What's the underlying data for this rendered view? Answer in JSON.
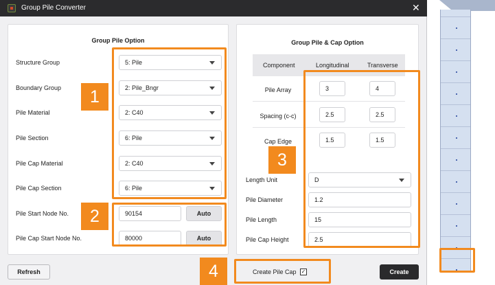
{
  "dialog": {
    "title": "Group Pile Converter",
    "close_glyph": "✕"
  },
  "left_panel": {
    "title": "Group Pile Option",
    "rows": [
      {
        "label": "Structure Group",
        "value": "5: Pile"
      },
      {
        "label": "Boundary Group",
        "value": "2: Pile_Bngr"
      },
      {
        "label": "Pile Material",
        "value": "2: C40"
      },
      {
        "label": "Pile Section",
        "value": "6: Pile"
      },
      {
        "label": "Pile Cap Material",
        "value": "2: C40"
      },
      {
        "label": "Pile Cap Section",
        "value": "6: Pile"
      }
    ],
    "node_rows": [
      {
        "label": "Pile Start Node No.",
        "value": "90154",
        "button": "Auto"
      },
      {
        "label": "Pile Cap Start Node No.",
        "value": "80000",
        "button": "Auto"
      }
    ]
  },
  "right_panel": {
    "title": "Group Pile & Cap Option",
    "table": {
      "headers": [
        "Component",
        "Longitudinal",
        "Transverse"
      ],
      "rows": [
        {
          "label": "Pile Array",
          "longitudinal": "3",
          "transverse": "4"
        },
        {
          "label": "Spacing (c-c)",
          "longitudinal": "2.5",
          "transverse": "2.5"
        },
        {
          "label": "Cap Edge",
          "longitudinal": "1.5",
          "transverse": "1.5"
        }
      ]
    },
    "length_unit": {
      "label": "Length Unit",
      "value": "D"
    },
    "fields": [
      {
        "label": "Pile Diameter",
        "value": "1.2"
      },
      {
        "label": "Pile Length",
        "value": "15"
      },
      {
        "label": "Pile Cap Height",
        "value": "2.5"
      }
    ]
  },
  "footer": {
    "refresh_label": "Refresh",
    "create_pile_cap_label": "Create Pile Cap",
    "create_pile_cap_checked": true,
    "checkmark": "✓",
    "create_label": "Create"
  },
  "annotations": [
    "1",
    "2",
    "3",
    "4",
    ""
  ],
  "colors": {
    "annotation": "#f28a1e",
    "titlebar": "#2b2b2d",
    "create_button": "#2a2a2c"
  }
}
